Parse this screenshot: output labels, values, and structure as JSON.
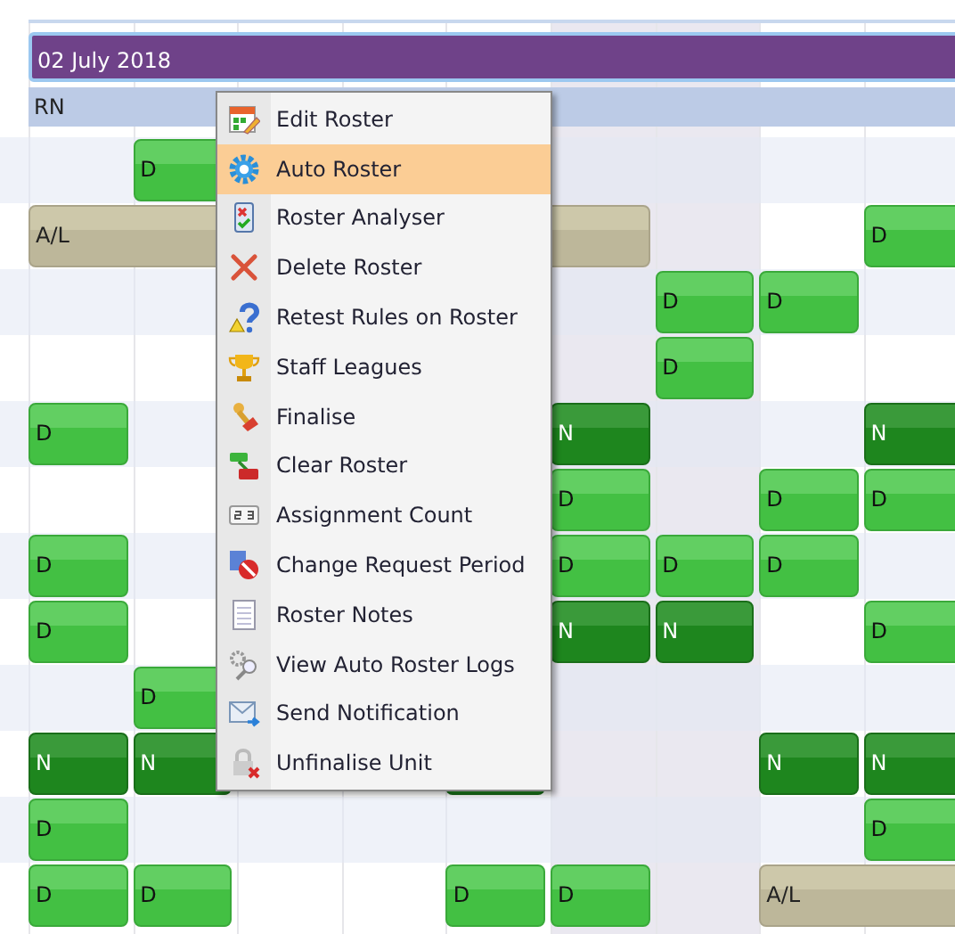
{
  "columns": [
    {
      "weekend": false
    },
    {
      "weekend": false
    },
    {
      "weekend": false
    },
    {
      "weekend": false
    },
    {
      "weekend": false
    },
    {
      "weekend": true
    },
    {
      "weekend": true
    },
    {
      "weekend": false
    },
    {
      "weekend": false
    }
  ],
  "date_bar": {
    "label": "02 July 2018"
  },
  "group": {
    "label": "RN"
  },
  "rows": [
    {
      "cells": [
        {
          "kind": "empty"
        },
        {
          "kind": "day",
          "label": "D"
        },
        {
          "kind": "empty"
        },
        {
          "kind": "empty"
        },
        {
          "kind": "empty"
        },
        {
          "kind": "empty"
        },
        {
          "kind": "empty"
        },
        {
          "kind": "empty"
        },
        {
          "kind": "empty"
        }
      ]
    },
    {
      "cells": [
        {
          "kind": "leave",
          "label": "A/L"
        },
        {
          "kind": "continued"
        },
        {
          "kind": "continued"
        },
        {
          "kind": "continued"
        },
        {
          "kind": "continued"
        },
        {
          "kind": "continued"
        },
        {
          "kind": "empty"
        },
        {
          "kind": "empty"
        },
        {
          "kind": "day",
          "label": "D"
        }
      ]
    },
    {
      "cells": [
        {
          "kind": "empty"
        },
        {
          "kind": "empty"
        },
        {
          "kind": "empty"
        },
        {
          "kind": "empty"
        },
        {
          "kind": "empty"
        },
        {
          "kind": "empty"
        },
        {
          "kind": "day",
          "label": "D"
        },
        {
          "kind": "day",
          "label": "D"
        },
        {
          "kind": "empty"
        }
      ]
    },
    {
      "cells": [
        {
          "kind": "empty"
        },
        {
          "kind": "empty"
        },
        {
          "kind": "empty"
        },
        {
          "kind": "empty"
        },
        {
          "kind": "empty"
        },
        {
          "kind": "empty"
        },
        {
          "kind": "day",
          "label": "D"
        },
        {
          "kind": "empty"
        },
        {
          "kind": "empty"
        }
      ]
    },
    {
      "cells": [
        {
          "kind": "day",
          "label": "D"
        },
        {
          "kind": "empty"
        },
        {
          "kind": "empty"
        },
        {
          "kind": "empty"
        },
        {
          "kind": "empty"
        },
        {
          "kind": "night",
          "label": "N"
        },
        {
          "kind": "empty"
        },
        {
          "kind": "empty"
        },
        {
          "kind": "night",
          "label": "N"
        }
      ]
    },
    {
      "cells": [
        {
          "kind": "empty"
        },
        {
          "kind": "empty"
        },
        {
          "kind": "empty"
        },
        {
          "kind": "empty"
        },
        {
          "kind": "empty"
        },
        {
          "kind": "day",
          "label": "D"
        },
        {
          "kind": "empty"
        },
        {
          "kind": "day",
          "label": "D"
        },
        {
          "kind": "day",
          "label": "D"
        }
      ]
    },
    {
      "cells": [
        {
          "kind": "day",
          "label": "D"
        },
        {
          "kind": "empty"
        },
        {
          "kind": "empty"
        },
        {
          "kind": "empty"
        },
        {
          "kind": "empty"
        },
        {
          "kind": "day",
          "label": "D"
        },
        {
          "kind": "day",
          "label": "D"
        },
        {
          "kind": "day",
          "label": "D"
        },
        {
          "kind": "empty"
        }
      ]
    },
    {
      "cells": [
        {
          "kind": "day",
          "label": "D"
        },
        {
          "kind": "empty"
        },
        {
          "kind": "empty"
        },
        {
          "kind": "empty"
        },
        {
          "kind": "empty"
        },
        {
          "kind": "night",
          "label": "N"
        },
        {
          "kind": "night",
          "label": "N"
        },
        {
          "kind": "empty"
        },
        {
          "kind": "day",
          "label": "D"
        }
      ]
    },
    {
      "cells": [
        {
          "kind": "empty"
        },
        {
          "kind": "day",
          "label": "D"
        },
        {
          "kind": "empty"
        },
        {
          "kind": "empty"
        },
        {
          "kind": "empty"
        },
        {
          "kind": "empty"
        },
        {
          "kind": "empty"
        },
        {
          "kind": "empty"
        },
        {
          "kind": "empty"
        }
      ]
    },
    {
      "cells": [
        {
          "kind": "night",
          "label": "N"
        },
        {
          "kind": "night",
          "label": "N"
        },
        {
          "kind": "empty"
        },
        {
          "kind": "empty"
        },
        {
          "kind": "night"
        },
        {
          "kind": "empty"
        },
        {
          "kind": "empty"
        },
        {
          "kind": "night",
          "label": "N"
        },
        {
          "kind": "night",
          "label": "N"
        }
      ]
    },
    {
      "cells": [
        {
          "kind": "day",
          "label": "D"
        },
        {
          "kind": "empty"
        },
        {
          "kind": "empty"
        },
        {
          "kind": "empty"
        },
        {
          "kind": "empty"
        },
        {
          "kind": "empty"
        },
        {
          "kind": "empty"
        },
        {
          "kind": "empty"
        },
        {
          "kind": "day",
          "label": "D"
        }
      ]
    },
    {
      "cells": [
        {
          "kind": "day",
          "label": "D"
        },
        {
          "kind": "day",
          "label": "D"
        },
        {
          "kind": "empty"
        },
        {
          "kind": "empty"
        },
        {
          "kind": "day",
          "label": "D"
        },
        {
          "kind": "day",
          "label": "D"
        },
        {
          "kind": "empty"
        },
        {
          "kind": "leave",
          "label": "A/L"
        },
        {
          "kind": "continued"
        }
      ]
    }
  ],
  "context_menu": {
    "items": [
      {
        "kind": "edit",
        "label": "Edit Roster",
        "selected": false
      },
      {
        "kind": "gear",
        "label": "Auto Roster",
        "selected": true
      },
      {
        "kind": "analyser",
        "label": "Roster Analyser",
        "selected": false
      },
      {
        "kind": "delete",
        "label": "Delete Roster",
        "selected": false
      },
      {
        "kind": "question",
        "label": "Retest Rules on Roster",
        "selected": false
      },
      {
        "kind": "trophy",
        "label": "Staff Leagues",
        "selected": false
      },
      {
        "kind": "stamp",
        "label": "Finalise",
        "selected": false
      },
      {
        "kind": "clear",
        "label": "Clear Roster",
        "selected": false
      },
      {
        "kind": "count",
        "label": "Assignment Count",
        "selected": false
      },
      {
        "kind": "period",
        "label": "Change Request Period",
        "selected": false
      },
      {
        "kind": "notes",
        "label": "Roster Notes",
        "selected": false
      },
      {
        "kind": "logs",
        "label": "View Auto Roster Logs",
        "selected": false
      },
      {
        "kind": "mail",
        "label": "Send Notification",
        "selected": false
      },
      {
        "kind": "lock",
        "label": "Unfinalise Unit",
        "selected": false
      }
    ]
  }
}
